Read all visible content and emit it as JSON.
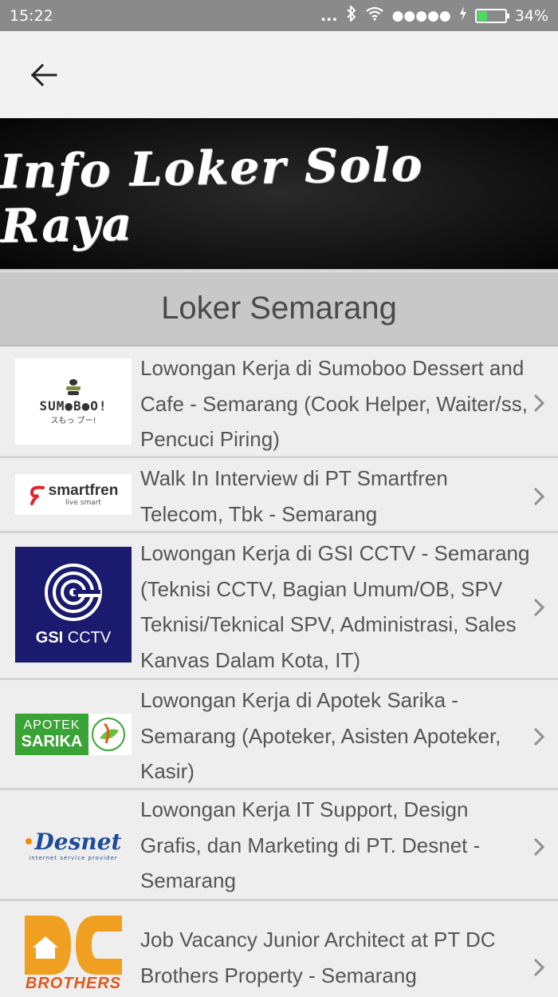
{
  "status_bar": {
    "time": "15:22",
    "more": "...",
    "signal_dots": "●●●●●",
    "battery_percent": "34%",
    "icons": [
      "bluetooth-icon",
      "wifi-icon",
      "signal-icon",
      "charging-icon",
      "battery-icon"
    ]
  },
  "app_bar": {
    "back_icon": "arrow-left-icon"
  },
  "banner": {
    "title": "Info Loker Solo Raya"
  },
  "section": {
    "title": "Loker Semarang"
  },
  "jobs": [
    {
      "title": "Lowongan Kerja di Sumoboo Dessert and Cafe - Semarang (Cook Helper, Waiter/ss, Pencuci Piring)",
      "logo": {
        "text": "SUM●B●O!",
        "subtext": "スもっ ブー!"
      }
    },
    {
      "title": "Walk In Interview di PT Smartfren Telecom, Tbk - Semarang",
      "logo": {
        "text": "smartfren",
        "subtext": "live smart"
      }
    },
    {
      "title": "Lowongan Kerja di GSI CCTV - Semarang (Teknisi CCTV, Bagian Umum/OB, SPV Teknisi/Teknical SPV, Administrasi, Sales Kanvas Dalam Kota, IT)",
      "logo": {
        "text_bold": "GSI",
        "text": "CCTV"
      }
    },
    {
      "title": "Lowongan Kerja di Apotek Sarika - Semarang (Apoteker, Asisten Apoteker, Kasir)",
      "logo": {
        "line1": "APOTEK",
        "line2": "SARIKA"
      }
    },
    {
      "title": "Lowongan Kerja IT Support, Design Grafis, dan Marketing di PT. Desnet - Semarang",
      "logo": {
        "text": "Desnet",
        "subtext": "internet service provider"
      }
    },
    {
      "title": "Job Vacancy Junior Architect at PT DC Brothers Property - Semarang",
      "logo": {
        "text": "DC",
        "subtext": "BROTHERS"
      }
    }
  ],
  "colors": {
    "status_bar": "#8a8a8a",
    "app_bar": "#f2f2f2",
    "section_header": "#c8c8c8",
    "list_bg": "#eeeeee",
    "text": "#555555",
    "battery": "#4cd964"
  }
}
